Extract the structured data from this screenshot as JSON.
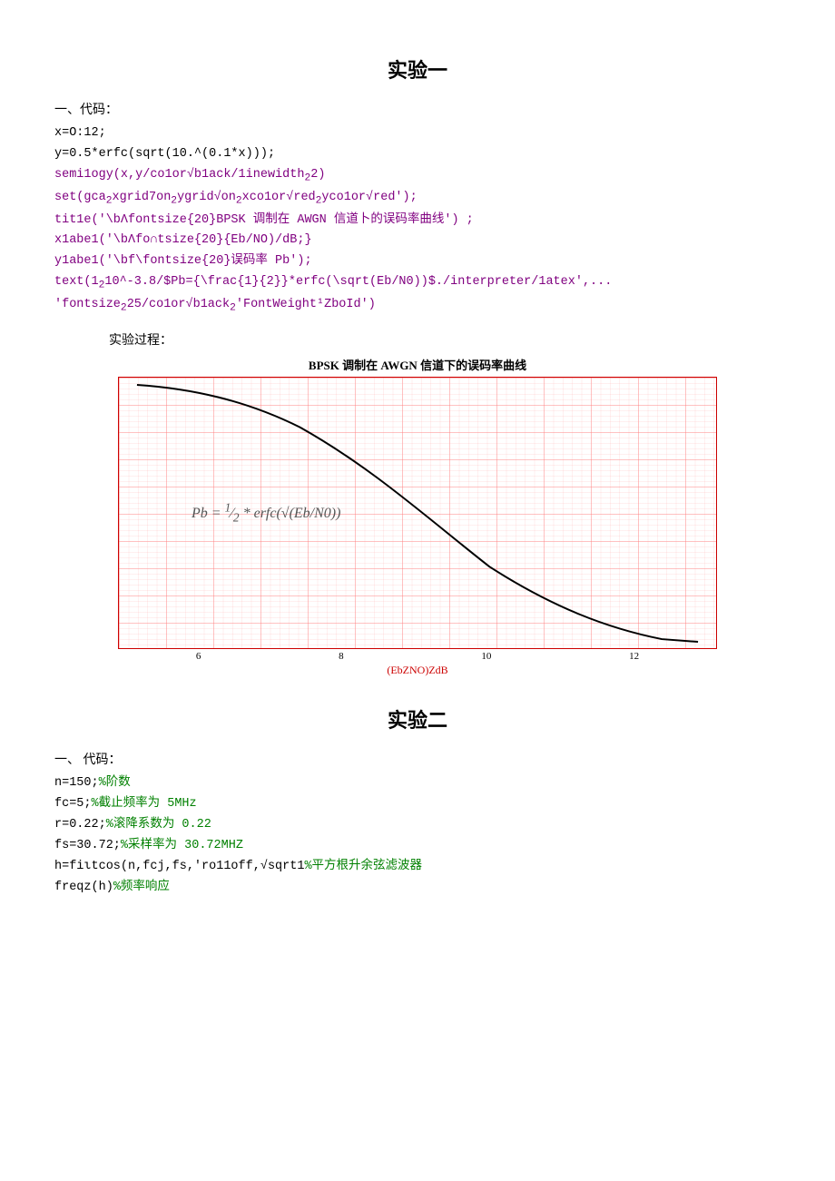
{
  "experiment1": {
    "title": "实验一",
    "section_label": "一、代码：",
    "code_lines": [
      {
        "text": "x=O:12;",
        "color": "black"
      },
      {
        "text": "y=0.5*erfc(sqrt(10.^(0.1*x)));",
        "color": "black"
      },
      {
        "text": "semi1ogy(x,y/co1or√b1ack/1inewidth₂2)",
        "color": "purple"
      },
      {
        "text": "set(gca₂xgrid7on₂ygrid√on₂xco1or√red₂yco1or√red');",
        "color": "purple"
      },
      {
        "text": "tit1e('\\bΛfontsize{20}BPSK 调制在 AWGN 信道卜的误码率曲线');",
        "color": "purple"
      },
      {
        "text": "x1abe1('\\bΛfo∩tsize{20}{Eb/NO)/dB;",
        "color": "purple"
      },
      {
        "text": "y1abe1('\\bf\\fontsize{20}误码率 Pb');",
        "color": "purple"
      },
      {
        "text": "text(1₂10^-3.8/$Pb={\\frac{1}{2}}*erfc(\\sqrt(Eb/N0))$./interpreter/1atex',...",
        "color": "purple"
      },
      {
        "text": "'fontsize₂25/co1or√b1ack₂'FontWeight¹ZboId')",
        "color": "purple"
      }
    ],
    "process_label": "实验过程：",
    "chart_title": "BPSK 调制在 AWGN 信道下的误码率曲线",
    "formula": "Pb = ½ * erfc(√(Eb/N0))",
    "x_axis_label": "(EbZNO)ZdB",
    "x_ticks": [
      "6",
      "8",
      "10",
      "12"
    ]
  },
  "experiment2": {
    "title": "实验二",
    "section_label": "一、      代码：",
    "code_lines": [
      {
        "text": "n=150;%阶数",
        "color": "mixed",
        "code": "n=150;",
        "comment": "%阶数"
      },
      {
        "text": "fc=5;%截止频率为 5MHz",
        "color": "mixed",
        "code": "fc=5;",
        "comment": "%截止频率为 5MHz"
      },
      {
        "text": "r=0.22;%滚降系数为 0.22",
        "color": "mixed",
        "code": "r=0.22;",
        "comment": "%滚降系数为 0.22"
      },
      {
        "text": "fs=30.72;%采样率为 30.72MHZ",
        "color": "mixed",
        "code": "fs=30.72;",
        "comment": "%采样率为 30.72MHZ"
      },
      {
        "text": "h=fiιtcos(n,fcj,fs,'ro11off,√sqrt1%平方根升余弦滤波器",
        "color": "mixed",
        "code": "h=fiιtcos(n,fcj,fs,'ro11off,√sqrt1%",
        "comment": "平方根升余弦滤波器"
      },
      {
        "text": "freqz(h)%频率响应",
        "color": "mixed",
        "code": "freqz(h)",
        "comment": "%频率响应"
      }
    ]
  }
}
